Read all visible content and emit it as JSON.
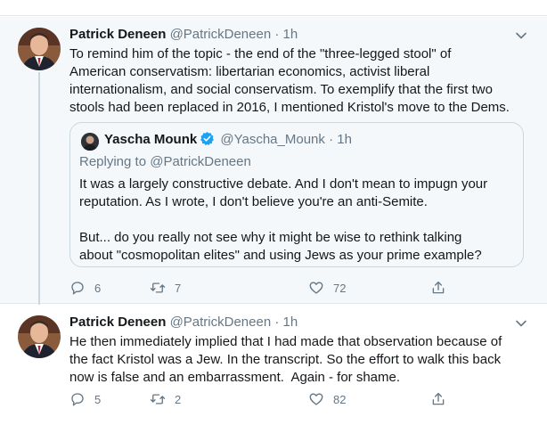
{
  "colors": {
    "primary_text": "#14171a",
    "secondary_text": "#657786",
    "verified_blue": "#1da1f2",
    "border": "#ccd6dd",
    "highlight_bg": "#f5f8fa"
  },
  "tweets": [
    {
      "author": {
        "name": "Patrick Deneen",
        "handle": "@PatrickDeneen"
      },
      "dot": "·",
      "time": "1h",
      "body": "To remind him of the topic - the end of the \"three-legged stool\" of\nAmerican conservatism: libertarian economics, activist liberal\ninternationalism, and social conservatism. To exemplify that the first two\nstools had been replaced in 2016, I mentioned Kristol's move to the Dems.",
      "quote": {
        "author": {
          "name": "Yascha Mounk",
          "handle": "@Yascha_Mounk"
        },
        "dot": "·",
        "time": "1h",
        "replying_to": "Replying to @PatrickDeneen",
        "body": "It was a largely constructive debate. And I don't mean to impugn your\nreputation. As I wrote, I don't believe you're an anti-Semite.\n\nBut... do you really not see why it might be wise to rethink talking\nabout \"cosmopolitan elites\" and using Jews as your prime example?"
      },
      "actions": {
        "replies": "6",
        "retweets": "7",
        "likes": "72"
      }
    },
    {
      "author": {
        "name": "Patrick Deneen",
        "handle": "@PatrickDeneen"
      },
      "dot": "·",
      "time": "1h",
      "body": "He then immediately implied that I had made that observation because of\nthe fact Kristol was a Jew. In the transcript. So the effort to walk this back\nnow is false and an embarrassment.  Again - for shame.",
      "actions": {
        "replies": "5",
        "retweets": "2",
        "likes": "82"
      }
    }
  ],
  "icons": [
    "avatar-photo",
    "chevron-down-icon",
    "verified-badge-icon",
    "reply-icon",
    "retweet-icon",
    "like-icon",
    "share-icon"
  ]
}
